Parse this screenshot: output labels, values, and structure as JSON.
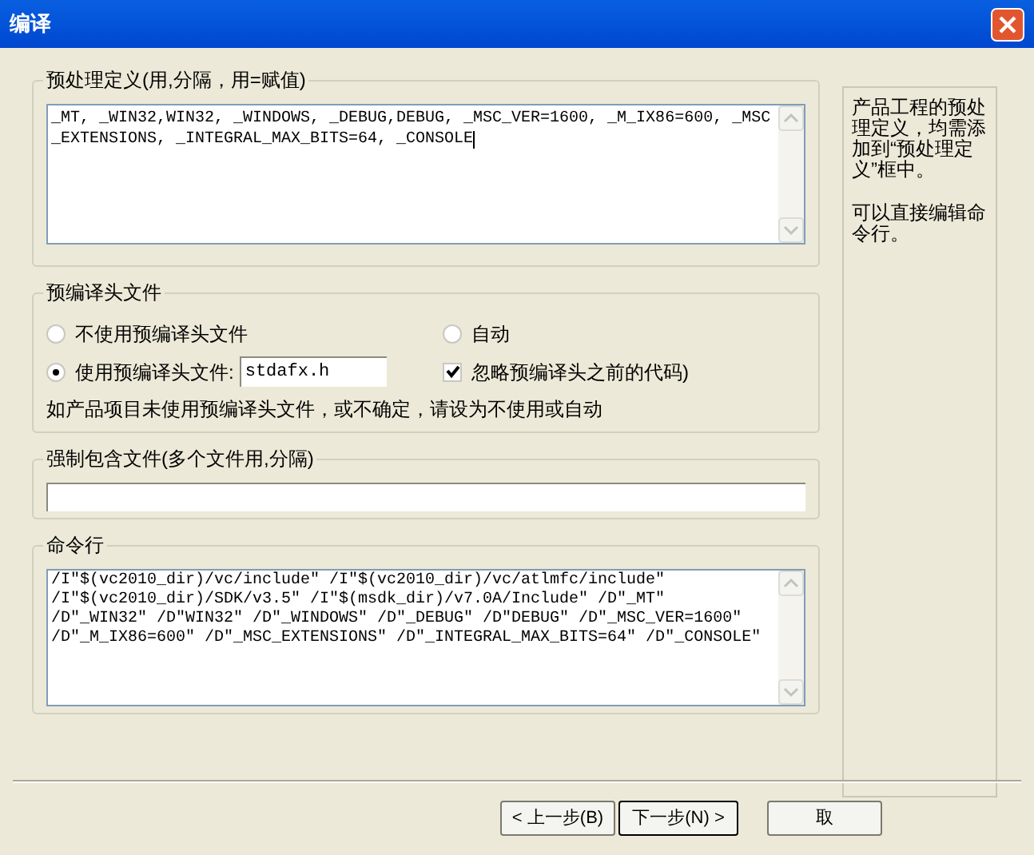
{
  "window": {
    "title": "编译"
  },
  "preprocessor": {
    "legend": "预处理定义(用,分隔，用=赋值)",
    "value": "_MT, _WIN32,WIN32, _WINDOWS, _DEBUG,DEBUG, _MSC_VER=1600, _M_IX86=600, _MSC_EXTENSIONS, _INTEGRAL_MAX_BITS=64, _CONSOLE"
  },
  "pch": {
    "legend": "预编译头文件",
    "options": [
      {
        "label": "不使用预编译头文件",
        "selected": false
      },
      {
        "label": "使用预编译头文件:",
        "selected": true
      },
      {
        "label": "自动",
        "selected": false
      }
    ],
    "file": "stdafx.h",
    "ignore": {
      "label": "忽略预编译头之前的代码)",
      "checked": true
    },
    "note": "如产品项目未使用预编译头文件，或不确定，请设为不使用或自动"
  },
  "force_include": {
    "legend": "强制包含文件(多个文件用,分隔)"
  },
  "command_line": {
    "legend": "命令行",
    "lines": [
      "/I\"$(vc2010_dir)/vc/include\" /I\"$(vc2010_dir)/vc/atlmfc/include\"",
      "/I\"$(vc2010_dir)/SDK/v3.5\" /I\"$(msdk_dir)/v7.0A/Include\" /D\"_MT\"",
      "/D\"_WIN32\" /D\"WIN32\" /D\"_WINDOWS\" /D\"_DEBUG\" /D\"DEBUG\" /D\"_MSC_VER=1600\"",
      "/D\"_M_IX86=600\" /D\"_MSC_EXTENSIONS\" /D\"_INTEGRAL_MAX_BITS=64\" /D\"_CONSOLE\""
    ]
  },
  "help": [
    "产品工程的预处理定义，均需添加到“预处理定义”框中。",
    "可以直接编辑命令行。"
  ],
  "buttons": [
    {
      "label": "< 上一步(B)",
      "default": false
    },
    {
      "label": "下一步(N) >",
      "default": true
    },
    {
      "label": "取",
      "default": false
    }
  ]
}
